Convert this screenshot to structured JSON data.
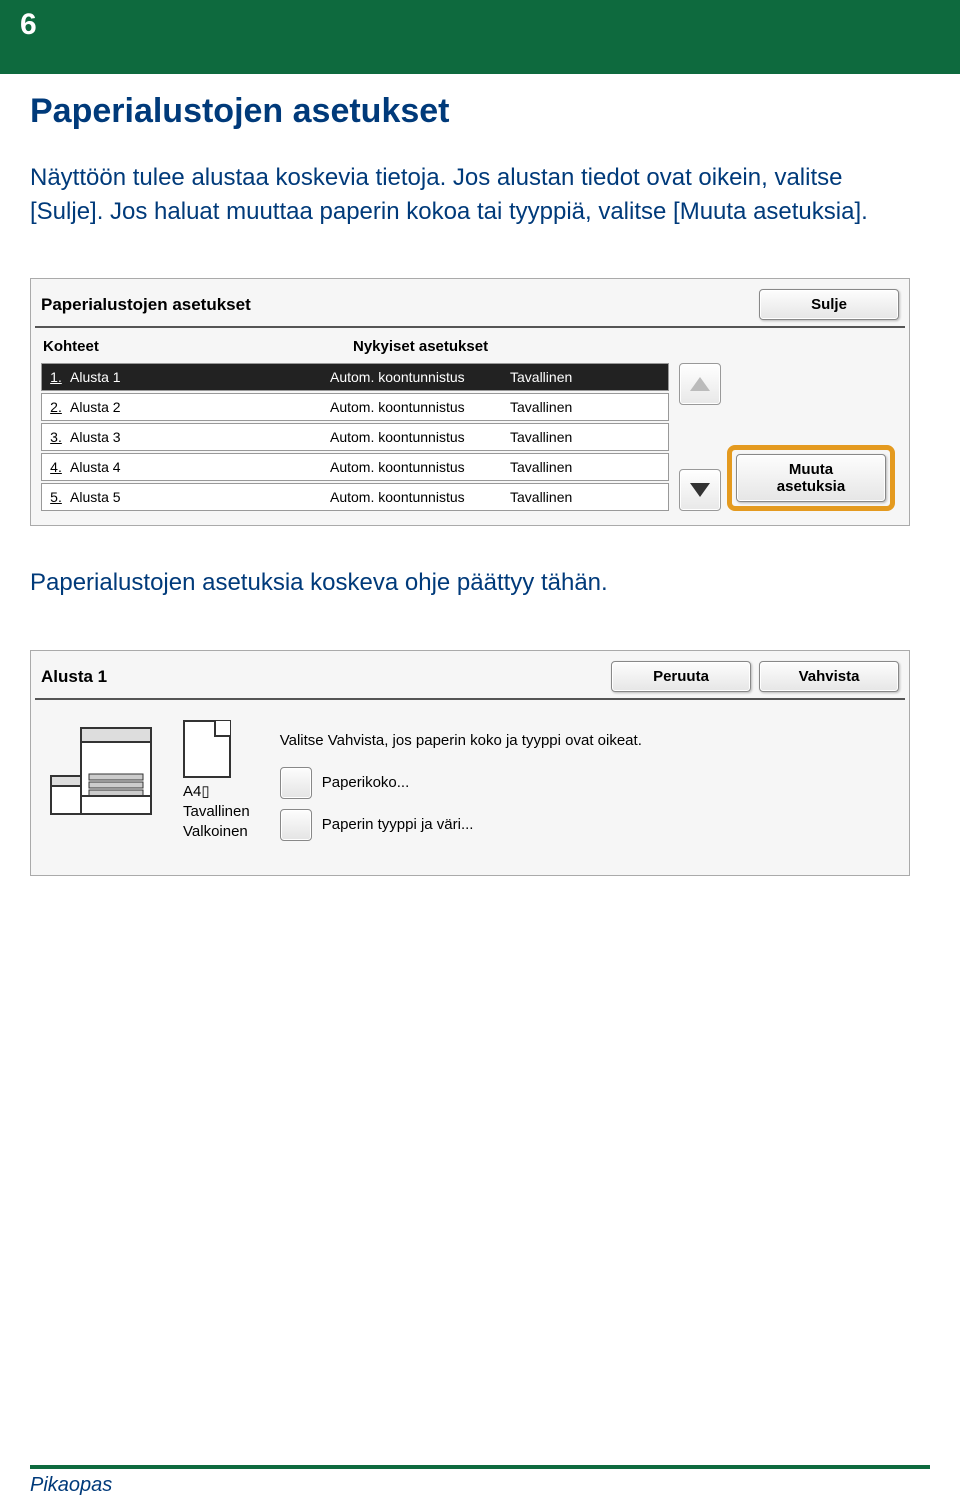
{
  "page_number": "6",
  "title": "Paperialustojen asetukset",
  "intro": "Näyttöön tulee alustaa koskevia tietoja. Jos alustan tiedot ovat oikein, valitse [Sulje]. Jos haluat muuttaa paperin kokoa tai tyyppiä, valitse [Muuta asetuksia].",
  "panel1": {
    "title": "Paperialustojen asetukset",
    "close": "Sulje",
    "headers": {
      "kohteet": "Kohteet",
      "nykyiset": "Nykyiset asetukset"
    },
    "rows": [
      {
        "num": "1.",
        "label": "Alusta 1",
        "c1": "Autom. koontunnistus",
        "c2": "Tavallinen",
        "selected": true
      },
      {
        "num": "2.",
        "label": "Alusta 2",
        "c1": "Autom. koontunnistus",
        "c2": "Tavallinen",
        "selected": false
      },
      {
        "num": "3.",
        "label": "Alusta 3",
        "c1": "Autom. koontunnistus",
        "c2": "Tavallinen",
        "selected": false
      },
      {
        "num": "4.",
        "label": "Alusta 4",
        "c1": "Autom. koontunnistus",
        "c2": "Tavallinen",
        "selected": false
      },
      {
        "num": "5.",
        "label": "Alusta 5",
        "c1": "Autom. koontunnistus",
        "c2": "Tavallinen",
        "selected": false
      }
    ],
    "change": "Muuta\nasetuksia"
  },
  "mid_text": "Paperialustojen asetuksia koskeva ohje päättyy tähän.",
  "panel2": {
    "title": "Alusta 1",
    "cancel": "Peruuta",
    "confirm": "Vahvista",
    "paper": {
      "size": "A4",
      "orient_icon": "portrait-icon",
      "type": "Tavallinen",
      "color": "Valkoinen"
    },
    "instruction": "Valitse Vahvista, jos paperin koko ja tyyppi ovat oikeat.",
    "btn_size": "Paperikoko...",
    "btn_type": "Paperin tyyppi ja väri..."
  },
  "footer": "Pikaopas"
}
